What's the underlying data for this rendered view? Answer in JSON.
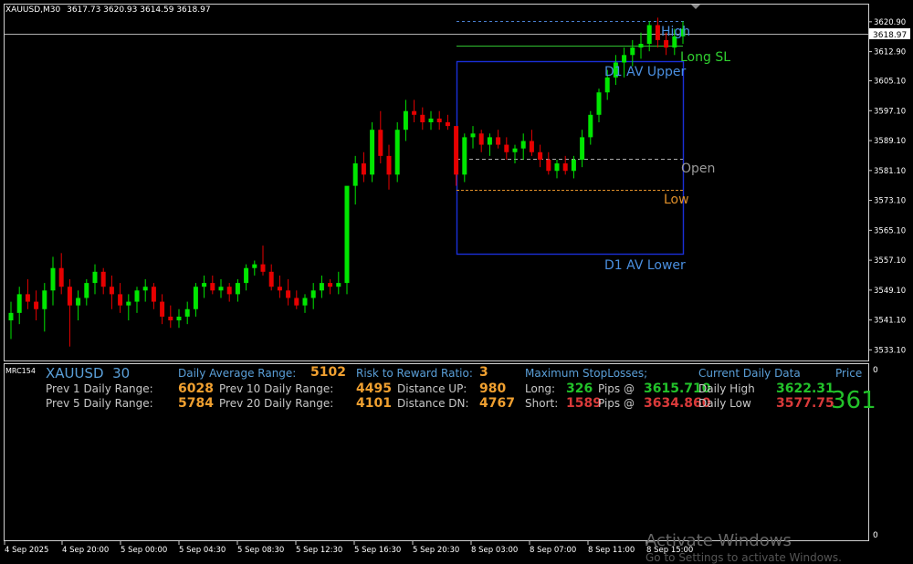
{
  "header": {
    "symbol": "XAUUSD,M30",
    "ohlc": "3617.73 3620.93 3614.59 3618.97"
  },
  "subwindow_label": "MRC154",
  "price_axis": {
    "ticks": [
      "3620.90",
      "3612.90",
      "3605.10",
      "3597.10",
      "3589.10",
      "3581.10",
      "3573.10",
      "3565.10",
      "3557.10",
      "3549.10",
      "3541.10",
      "3533.10"
    ],
    "current": "3618.97"
  },
  "sub_axis": {
    "top": "0",
    "bottom": "0"
  },
  "time_axis": [
    "4 Sep 2025",
    "4 Sep 20:00",
    "5 Sep 00:00",
    "5 Sep 04:30",
    "5 Sep 08:30",
    "5 Sep 12:30",
    "5 Sep 16:30",
    "5 Sep 20:30",
    "8 Sep 03:00",
    "8 Sep 07:00",
    "8 Sep 11:00",
    "8 Sep 15:00"
  ],
  "levels": {
    "high": "High",
    "long_sl": "Long SL",
    "upper": "D1 AV Upper",
    "open": "Open",
    "low": "Low",
    "lower": "D1 AV Lower"
  },
  "colors": {
    "bull": "#00e600",
    "bear": "#e60000",
    "box": "#1a2fd8",
    "grid": "#e0e0e0"
  },
  "panel": {
    "symbol": "XAUUSD",
    "tf": "30",
    "daily_avg_label": "Daily Average Range:",
    "daily_avg_val": "5102",
    "prev1_label": "Prev 1 Daily Range:",
    "prev1_val": "6028",
    "prev5_label": "Prev 5 Daily Range:",
    "prev5_val": "5784",
    "prev10_label": "Prev 10 Daily Range:",
    "prev10_val": "4495",
    "prev20_label": "Prev 20 Daily Range:",
    "prev20_val": "4101",
    "rr_label": "Risk to Reward Ratio:",
    "rr_val": "3",
    "dist_up_label": "Distance UP:",
    "dist_up_val": "980",
    "dist_dn_label": "Distance DN:",
    "dist_dn_val": "4767",
    "maxsl_label": "Maximum StopLosses;",
    "long_label": "Long:",
    "long_val": "326",
    "long_pips": "Pips @",
    "long_price": "3615.710",
    "short_label": "Short:",
    "short_val": "1589",
    "short_pips": "Pips @",
    "short_price": "3634.860",
    "cur_label": "Current Daily Data",
    "dhigh_label": "Daily High",
    "dhigh_val": "3622.31",
    "dlow_label": "Daily Low",
    "dlow_val": "3577.75",
    "price_label": "Price",
    "price_val": "361"
  },
  "watermark": {
    "line1": "Activate Windows",
    "line2": "Go to Settings to activate Windows."
  },
  "chart_data": {
    "type": "candlestick",
    "ylim": [
      3531.0,
      3625.5
    ],
    "candles": [
      [
        3541,
        3546,
        3536,
        3543
      ],
      [
        3543,
        3550,
        3540,
        3548
      ],
      [
        3548,
        3552,
        3544,
        3546
      ],
      [
        3546,
        3549,
        3541,
        3544
      ],
      [
        3544,
        3551,
        3538,
        3549
      ],
      [
        3549,
        3558,
        3545,
        3555
      ],
      [
        3555,
        3559,
        3548,
        3550
      ],
      [
        3550,
        3552,
        3534,
        3545
      ],
      [
        3545,
        3549,
        3541,
        3547
      ],
      [
        3547,
        3552,
        3545,
        3551
      ],
      [
        3551,
        3556,
        3548,
        3554
      ],
      [
        3554,
        3555,
        3548,
        3550
      ],
      [
        3550,
        3553,
        3544,
        3548
      ],
      [
        3548,
        3551,
        3543,
        3545
      ],
      [
        3545,
        3548,
        3541,
        3546
      ],
      [
        3546,
        3550,
        3543,
        3549
      ],
      [
        3549,
        3552,
        3546,
        3550
      ],
      [
        3550,
        3551,
        3544,
        3546
      ],
      [
        3546,
        3548,
        3540,
        3542
      ],
      [
        3542,
        3545,
        3539,
        3541
      ],
      [
        3541,
        3544,
        3539,
        3542
      ],
      [
        3542,
        3546,
        3540,
        3544
      ],
      [
        3544,
        3551,
        3542,
        3550
      ],
      [
        3550,
        3553,
        3547,
        3551
      ],
      [
        3551,
        3553,
        3548,
        3549
      ],
      [
        3549,
        3552,
        3547,
        3550
      ],
      [
        3550,
        3551,
        3546,
        3548
      ],
      [
        3548,
        3552,
        3546,
        3551
      ],
      [
        3551,
        3556,
        3549,
        3555
      ],
      [
        3555,
        3557,
        3553,
        3556
      ],
      [
        3556,
        3561,
        3553,
        3554
      ],
      [
        3554,
        3556,
        3549,
        3550
      ],
      [
        3550,
        3553,
        3547,
        3549
      ],
      [
        3549,
        3552,
        3545,
        3547
      ],
      [
        3547,
        3549,
        3544,
        3545
      ],
      [
        3545,
        3548,
        3543,
        3547
      ],
      [
        3547,
        3551,
        3544,
        3549
      ],
      [
        3549,
        3553,
        3547,
        3551
      ],
      [
        3551,
        3552,
        3548,
        3550
      ],
      [
        3550,
        3554,
        3548,
        3551
      ],
      [
        3551,
        3566,
        3548,
        3577
      ],
      [
        3577,
        3585,
        3572,
        3583
      ],
      [
        3583,
        3586,
        3578,
        3580
      ],
      [
        3580,
        3594,
        3578,
        3592
      ],
      [
        3592,
        3597,
        3583,
        3585
      ],
      [
        3585,
        3588,
        3576,
        3580
      ],
      [
        3580,
        3594,
        3578,
        3592
      ],
      [
        3592,
        3600,
        3589,
        3597
      ],
      [
        3597,
        3600,
        3594,
        3596
      ],
      [
        3596,
        3598,
        3592,
        3594
      ],
      [
        3594,
        3597,
        3592,
        3595
      ],
      [
        3595,
        3597,
        3592,
        3594
      ],
      [
        3594,
        3596,
        3592,
        3593
      ],
      [
        3593,
        3591,
        3577,
        3580
      ],
      [
        3580,
        3591,
        3578,
        3590
      ],
      [
        3590,
        3593,
        3587,
        3591
      ],
      [
        3591,
        3592,
        3586,
        3588
      ],
      [
        3588,
        3591,
        3585,
        3590
      ],
      [
        3590,
        3592,
        3587,
        3588
      ],
      [
        3588,
        3590,
        3584,
        3586
      ],
      [
        3586,
        3588,
        3583,
        3587
      ],
      [
        3587,
        3591,
        3584,
        3589
      ],
      [
        3589,
        3592,
        3585,
        3586
      ],
      [
        3586,
        3588,
        3582,
        3584
      ],
      [
        3584,
        3586,
        3580,
        3581
      ],
      [
        3581,
        3584,
        3579,
        3583
      ],
      [
        3583,
        3585,
        3580,
        3581
      ],
      [
        3581,
        3585,
        3579,
        3584
      ],
      [
        3584,
        3592,
        3582,
        3590
      ],
      [
        3590,
        3597,
        3588,
        3596
      ],
      [
        3596,
        3603,
        3594,
        3602
      ],
      [
        3602,
        3608,
        3600,
        3606
      ],
      [
        3606,
        3612,
        3604,
        3610
      ],
      [
        3610,
        3614,
        3606,
        3612
      ],
      [
        3612,
        3616,
        3609,
        3614
      ],
      [
        3614,
        3618,
        3611,
        3615
      ],
      [
        3615,
        3621,
        3613,
        3620
      ],
      [
        3620,
        3622,
        3614,
        3616
      ],
      [
        3616,
        3618,
        3612,
        3614
      ],
      [
        3614,
        3619,
        3612,
        3617
      ],
      [
        3617,
        3621,
        3615,
        3619
      ]
    ]
  }
}
